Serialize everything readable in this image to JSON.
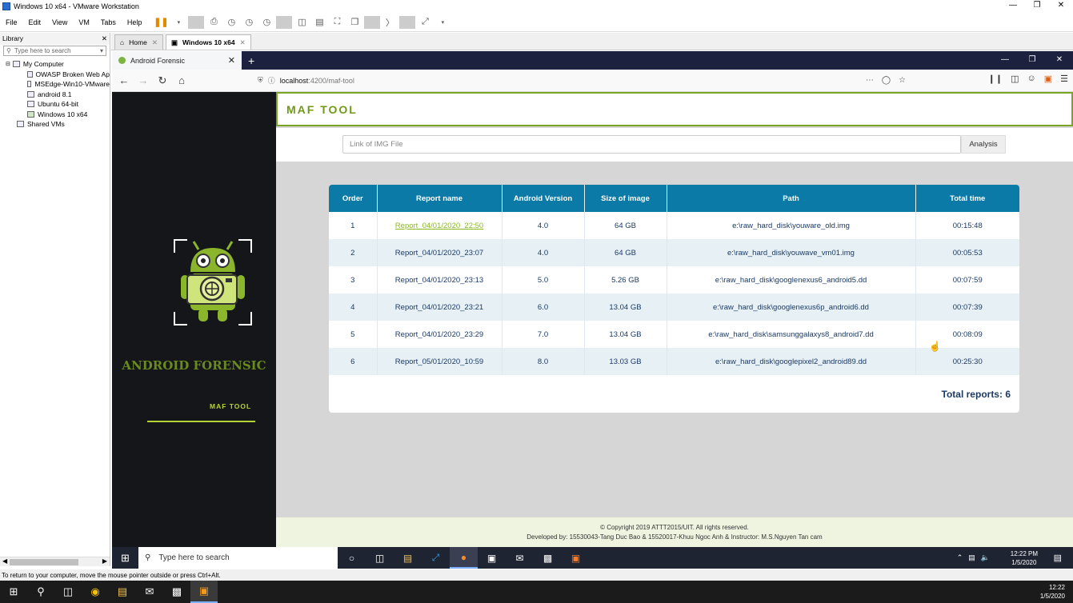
{
  "vmware": {
    "title": "Windows 10 x64 - VMware Workstation",
    "menu": [
      "File",
      "Edit",
      "View",
      "VM",
      "Tabs",
      "Help"
    ],
    "library": {
      "label": "Library",
      "search_placeholder": "Type here to search",
      "tree": [
        "My Computer",
        "OWASP Broken Web Ap",
        "MSEdge-Win10-VMware",
        "android 8.1",
        "Ubuntu 64-bit",
        "Windows 10 x64",
        "Shared VMs"
      ]
    },
    "tabs": [
      "Home",
      "Windows 10 x64"
    ],
    "status": "To return to your computer, move the mouse pointer outside or press Ctrl+Alt."
  },
  "browser": {
    "tab_title": "Android Forensic",
    "url_host": "localhost",
    "url_path": ":4200/maf-tool"
  },
  "app": {
    "header_title": "MAF TOOL",
    "side_title": "ANDROID FORENSIC",
    "side_subtitle": "MAF TOOL",
    "input_placeholder": "Link of IMG File",
    "analysis_label": "Analysis",
    "columns": [
      "Order",
      "Report name",
      "Android Version",
      "Size of image",
      "Path",
      "Total time"
    ],
    "rows": [
      [
        "1",
        "Report_04/01/2020_22:50",
        "4.0",
        "64 GB",
        "e:\\raw_hard_disk\\youware_old.img",
        "00:15:48"
      ],
      [
        "2",
        "Report_04/01/2020_23:07",
        "4.0",
        "64 GB",
        "e:\\raw_hard_disk\\youwave_vm01.img",
        "00:05:53"
      ],
      [
        "3",
        "Report_04/01/2020_23:13",
        "5.0",
        "5.26 GB",
        "e:\\raw_hard_disk\\googlenexus6_android5.dd",
        "00:07:59"
      ],
      [
        "4",
        "Report_04/01/2020_23:21",
        "6.0",
        "13.04 GB",
        "e:\\raw_hard_disk\\googlenexus6p_android6.dd",
        "00:07:39"
      ],
      [
        "5",
        "Report_04/01/2020_23:29",
        "7.0",
        "13.04 GB",
        "e:\\raw_hard_disk\\samsunggalaxys8_android7.dd",
        "00:08:09"
      ],
      [
        "6",
        "Report_05/01/2020_10:59",
        "8.0",
        "13.03 GB",
        "e:\\raw_hard_disk\\googlepixel2_android89.dd",
        "00:25:30"
      ]
    ],
    "total_reports": "Total reports: 6",
    "footer_line1": "© Copyright 2019 ATTT2015/UIT. All rights reserved.",
    "footer_line2": "Developed by: 15530043-Tang Duc Bao & 15520017-Khuu Ngoc Anh & Instructor: M.S.Nguyen Tan cam"
  },
  "guest_taskbar": {
    "search_placeholder": "Type here to search",
    "time": "12:22 PM",
    "date": "1/5/2020"
  },
  "host_taskbar": {
    "time": "12:22",
    "date": "1/5/2020"
  }
}
